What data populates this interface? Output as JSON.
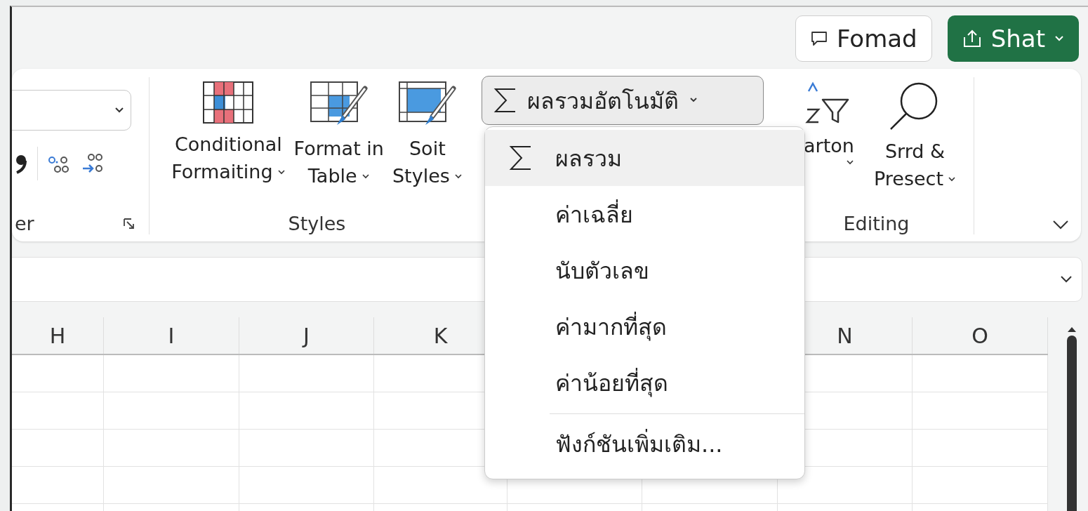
{
  "top_bar": {
    "buttons": [
      {
        "kind": "comment",
        "label": "Fomad"
      },
      {
        "kind": "share",
        "label": "Shat"
      }
    ]
  },
  "ribbon": {
    "number_group": {
      "label": "er"
    },
    "styles_group": {
      "label": "Styles",
      "buttons": [
        {
          "kind": "conditional",
          "lines": [
            "Conditional",
            "Formaiting"
          ]
        },
        {
          "kind": "table",
          "lines": [
            "Format in",
            "Table"
          ]
        },
        {
          "kind": "cell",
          "lines": [
            "Soit",
            "Styles"
          ]
        }
      ]
    },
    "autosum": {
      "label": "ผลรวมอัตโนมัติ",
      "expanded": true
    },
    "editing_group": {
      "label": "Editing",
      "sort": {
        "label": "arton"
      },
      "find": {
        "lines": [
          "Srrd &",
          "Presect"
        ]
      }
    }
  },
  "sheet": {
    "columns": [
      {
        "label": "H"
      },
      {
        "label": "I"
      },
      {
        "label": "J"
      },
      {
        "label": "K"
      },
      {},
      {},
      {
        "label": "N"
      },
      {
        "label": "O"
      }
    ]
  },
  "autosum_menu": {
    "items": [
      {
        "kind": "sum",
        "label": "ผลรวม",
        "selected": true
      },
      {
        "kind": "plain",
        "label": "ค่าเฉลี่ย",
        "selected": false
      },
      {
        "kind": "plain",
        "label": "นับตัวเลข",
        "selected": false
      },
      {
        "kind": "plain",
        "label": "ค่ามากที่สุด",
        "selected": false
      },
      {
        "kind": "plain",
        "label": "ค่าน้อยที่สุด",
        "selected": false
      },
      {
        "kind": "separator"
      },
      {
        "kind": "plain",
        "label": "ฟังก์ชันเพิ่มเติม...",
        "selected": false
      }
    ]
  }
}
